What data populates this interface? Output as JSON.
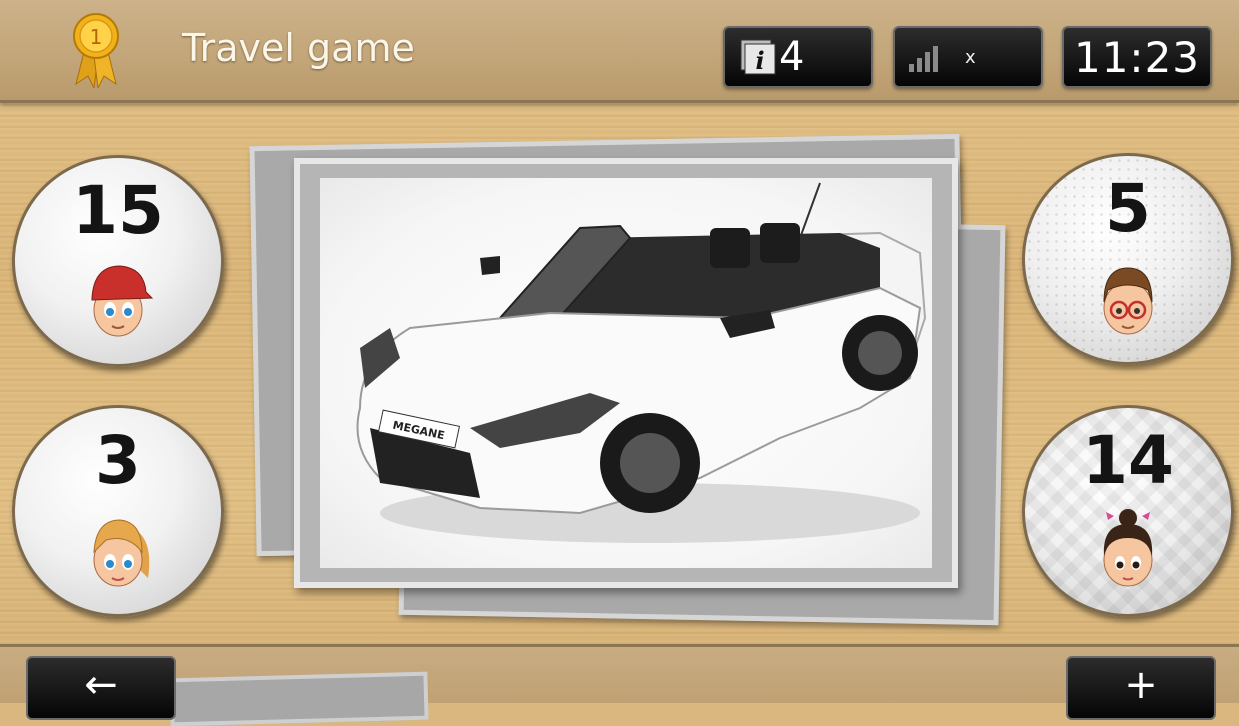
{
  "app": {
    "title": "Travel game"
  },
  "status": {
    "info_icon": "info-icon",
    "info_count": "4",
    "signal_icon": "signal-bars-icon",
    "signal_label": "x",
    "clock": "11:23"
  },
  "players": [
    {
      "score": "15",
      "avatar": "boy-red-cap-avatar"
    },
    {
      "score": "3",
      "avatar": "girl-ponytail-avatar"
    },
    {
      "score": "5",
      "avatar": "boy-glasses-avatar"
    },
    {
      "score": "14",
      "avatar": "girl-bun-avatar"
    }
  ],
  "card": {
    "image": "white-convertible-car-photo",
    "plate": "MEGANE"
  },
  "nav": {
    "back_icon": "←",
    "add_icon": "+"
  },
  "colors": {
    "wood": "#dcb77b",
    "bar": "#c2a578",
    "button": "#111111",
    "text_light": "#fbf6ea"
  }
}
